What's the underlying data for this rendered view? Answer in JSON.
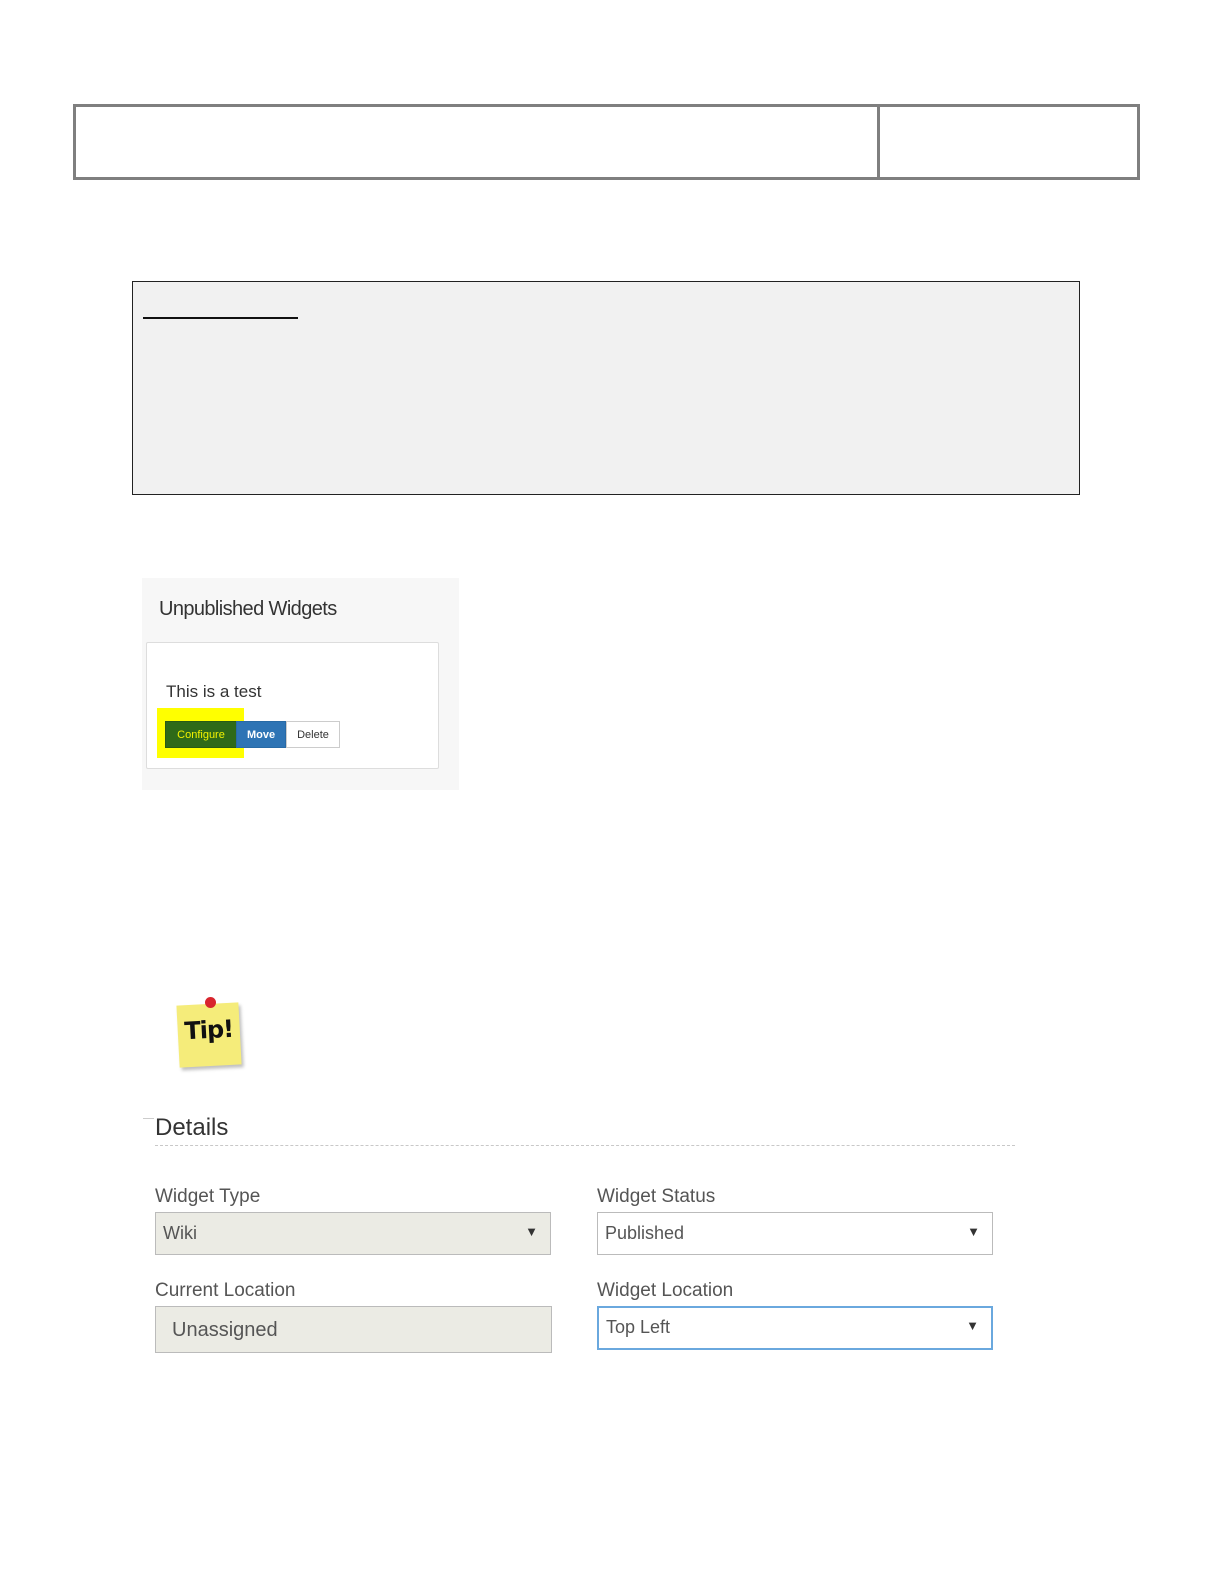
{
  "widgets_panel": {
    "title": "Unpublished Widgets",
    "card_text": "This is a test",
    "buttons": {
      "configure": "Configure",
      "move": "Move",
      "delete": "Delete"
    },
    "highlight_color": "#ffff00"
  },
  "tip": {
    "label": "Tip!"
  },
  "details": {
    "title": "Details",
    "widget_type": {
      "label": "Widget Type",
      "value": "Wiki"
    },
    "widget_status": {
      "label": "Widget Status",
      "value": "Published"
    },
    "current_location": {
      "label": "Current Location",
      "value": "Unassigned"
    },
    "widget_location": {
      "label": "Widget Location",
      "value": "Top Left"
    }
  },
  "icons": {
    "dropdown": "▼"
  },
  "colors": {
    "configure_button": "#2f6a18",
    "move_button": "#2e74b5",
    "focus_border": "#6aa8de",
    "tip_note": "#f5ec7a"
  }
}
